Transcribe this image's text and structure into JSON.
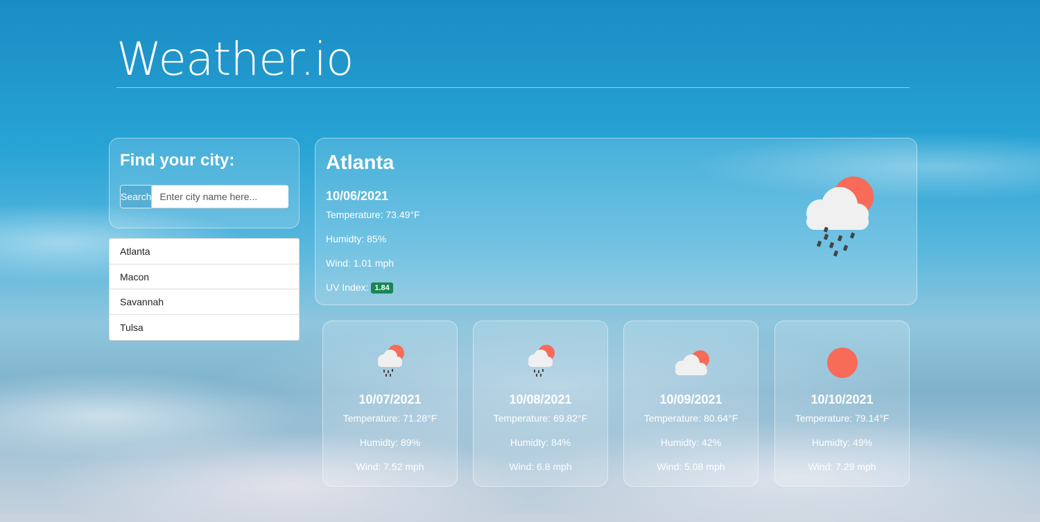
{
  "app": {
    "title": "Weather.io"
  },
  "search": {
    "heading": "Find your city:",
    "button_label": "Search",
    "placeholder": "Enter city name here..."
  },
  "history": [
    "Atlanta",
    "Macon",
    "Savannah",
    "Tulsa"
  ],
  "current": {
    "city": "Atlanta",
    "date": "10/06/2021",
    "temperature": "Temperature: 73.49°F",
    "humidity": "Humidty: 85%",
    "wind": "Wind: 1.01 mph",
    "uv_label": "UV Index:",
    "uv_value": "1.84",
    "uv_color": "#198754",
    "icon": "rain-sun-cloud-icon"
  },
  "forecast": [
    {
      "date": "10/07/2021",
      "temperature": "Temperature: 71.28°F",
      "humidity": "Humidty: 89%",
      "wind": "Wind: 7.52 mph",
      "icon": "rain-sun-cloud-icon"
    },
    {
      "date": "10/08/2021",
      "temperature": "Temperature: 69.82°F",
      "humidity": "Humidty: 84%",
      "wind": "Wind: 6.8 mph",
      "icon": "rain-sun-cloud-icon"
    },
    {
      "date": "10/09/2021",
      "temperature": "Temperature: 80.64°F",
      "humidity": "Humidty: 42%",
      "wind": "Wind: 5.08 mph",
      "icon": "sun-cloud-icon"
    },
    {
      "date": "10/10/2021",
      "temperature": "Temperature: 79.14°F",
      "humidity": "Humidty: 49%",
      "wind": "Wind: 7.29 mph",
      "icon": "sun-icon"
    }
  ],
  "colors": {
    "sun": "#f76b58",
    "cloud": "#f2f2f2",
    "rain": "#444444"
  }
}
